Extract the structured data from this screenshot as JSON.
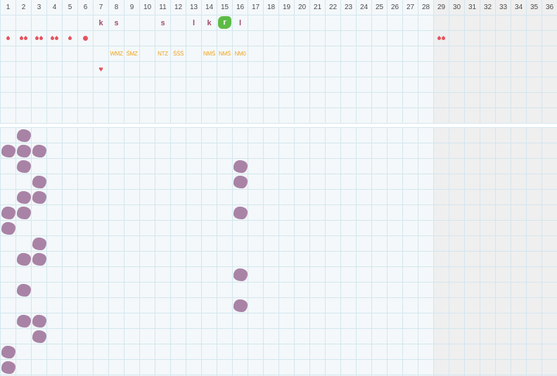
{
  "colors": {
    "grid_line": "#d3e6ee",
    "background": "#f4f8fa",
    "future_panel": "#efefef",
    "letter": "#a24f6b",
    "code": "#f1a520",
    "drop": "#e5535e",
    "heart": "#e5535e",
    "highlight": "#5dbb46",
    "blob": "#a983a6"
  },
  "calendar": {
    "days": [
      "1",
      "2",
      "3",
      "4",
      "5",
      "6",
      "7",
      "8",
      "9",
      "10",
      "11",
      "12",
      "13",
      "14",
      "15",
      "16",
      "17",
      "18",
      "19",
      "20",
      "21",
      "22",
      "23",
      "24",
      "25",
      "26",
      "27",
      "28",
      "29",
      "30",
      "31",
      "32",
      "33",
      "34",
      "35",
      "36"
    ],
    "current_day": 28,
    "letters": [
      {
        "day": 7,
        "text": "k"
      },
      {
        "day": 8,
        "text": "s"
      },
      {
        "day": 11,
        "text": "s"
      },
      {
        "day": 13,
        "text": "l"
      },
      {
        "day": 14,
        "text": "k"
      },
      {
        "day": 15,
        "text": "r",
        "highlight": true
      },
      {
        "day": 16,
        "text": "l"
      }
    ],
    "bleeding": [
      {
        "day": 1,
        "type": "drop",
        "count": 1
      },
      {
        "day": 2,
        "type": "drop",
        "count": 2
      },
      {
        "day": 3,
        "type": "drop",
        "count": 2
      },
      {
        "day": 4,
        "type": "drop",
        "count": 2
      },
      {
        "day": 5,
        "type": "drop",
        "count": 1
      },
      {
        "day": 6,
        "type": "dot",
        "count": 1
      },
      {
        "day": 29,
        "type": "drop",
        "count": 2
      }
    ],
    "codes": [
      {
        "day": 8,
        "text": "WMZ"
      },
      {
        "day": 9,
        "text": "ŚMZ"
      },
      {
        "day": 11,
        "text": "NTZ"
      },
      {
        "day": 12,
        "text": "ŚŚŚ"
      },
      {
        "day": 14,
        "text": "NMŚ"
      },
      {
        "day": 15,
        "text": "NMŚ"
      },
      {
        "day": 16,
        "text": "NM0"
      }
    ],
    "hearts": [
      {
        "day": 7,
        "symbol": "♥"
      }
    ],
    "marks": [
      {
        "row": 0,
        "day": 2
      },
      {
        "row": 1,
        "day": 1
      },
      {
        "row": 1,
        "day": 2
      },
      {
        "row": 1,
        "day": 3
      },
      {
        "row": 2,
        "day": 2
      },
      {
        "row": 2,
        "day": 16
      },
      {
        "row": 3,
        "day": 3
      },
      {
        "row": 3,
        "day": 16
      },
      {
        "row": 4,
        "day": 2
      },
      {
        "row": 4,
        "day": 3
      },
      {
        "row": 5,
        "day": 1
      },
      {
        "row": 5,
        "day": 2
      },
      {
        "row": 5,
        "day": 16
      },
      {
        "row": 6,
        "day": 1
      },
      {
        "row": 7,
        "day": 3
      },
      {
        "row": 8,
        "day": 2
      },
      {
        "row": 8,
        "day": 3
      },
      {
        "row": 9,
        "day": 16
      },
      {
        "row": 10,
        "day": 2
      },
      {
        "row": 11,
        "day": 16
      },
      {
        "row": 12,
        "day": 2
      },
      {
        "row": 12,
        "day": 3
      },
      {
        "row": 13,
        "day": 3
      },
      {
        "row": 14,
        "day": 1
      },
      {
        "row": 15,
        "day": 1
      }
    ]
  }
}
